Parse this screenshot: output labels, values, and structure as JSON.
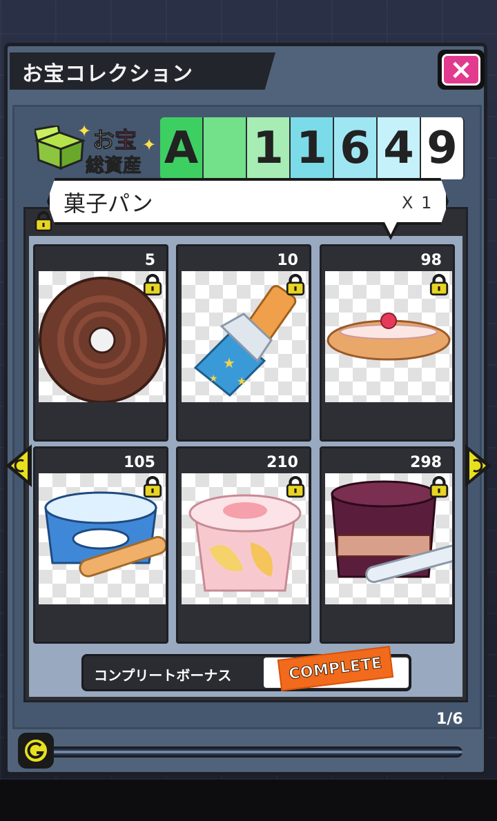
{
  "title": "お宝コレクション",
  "close_label": "×",
  "total_assets": {
    "label_prefix": "お",
    "label_highlight": "宝",
    "label_line2": "総資産",
    "rank": "A",
    "digits": [
      "",
      "1",
      "1",
      "6",
      "4",
      "9"
    ],
    "colors": [
      "#3ecf63",
      "#73e08a",
      "#a6ecb4",
      "#7cdbe8",
      "#9fe6f3",
      "#c5f1fa",
      "#ffffff"
    ]
  },
  "tooltip": {
    "name": "菓子パン",
    "quantity": "X 1"
  },
  "items": [
    {
      "value": "5",
      "icon": "chocolate-donut"
    },
    {
      "value": "10",
      "icon": "wrapped-snack-bar"
    },
    {
      "value": "98",
      "icon": "cream-bread"
    },
    {
      "value": "105",
      "icon": "yogurt-cup"
    },
    {
      "value": "210",
      "icon": "peach-jelly-cup"
    },
    {
      "value": "298",
      "icon": "grape-ice-cream"
    }
  ],
  "bonus": {
    "label": "コンプリートボーナス",
    "stamp": "COMPLETE"
  },
  "page_indicator": "1/6",
  "icons": {
    "close": "close-icon",
    "lock": "lock-icon",
    "prev": "left-arrow-icon",
    "next": "right-arrow-icon",
    "medal": "yokai-medal-icon",
    "treasure": "treasure-chest-icon"
  }
}
